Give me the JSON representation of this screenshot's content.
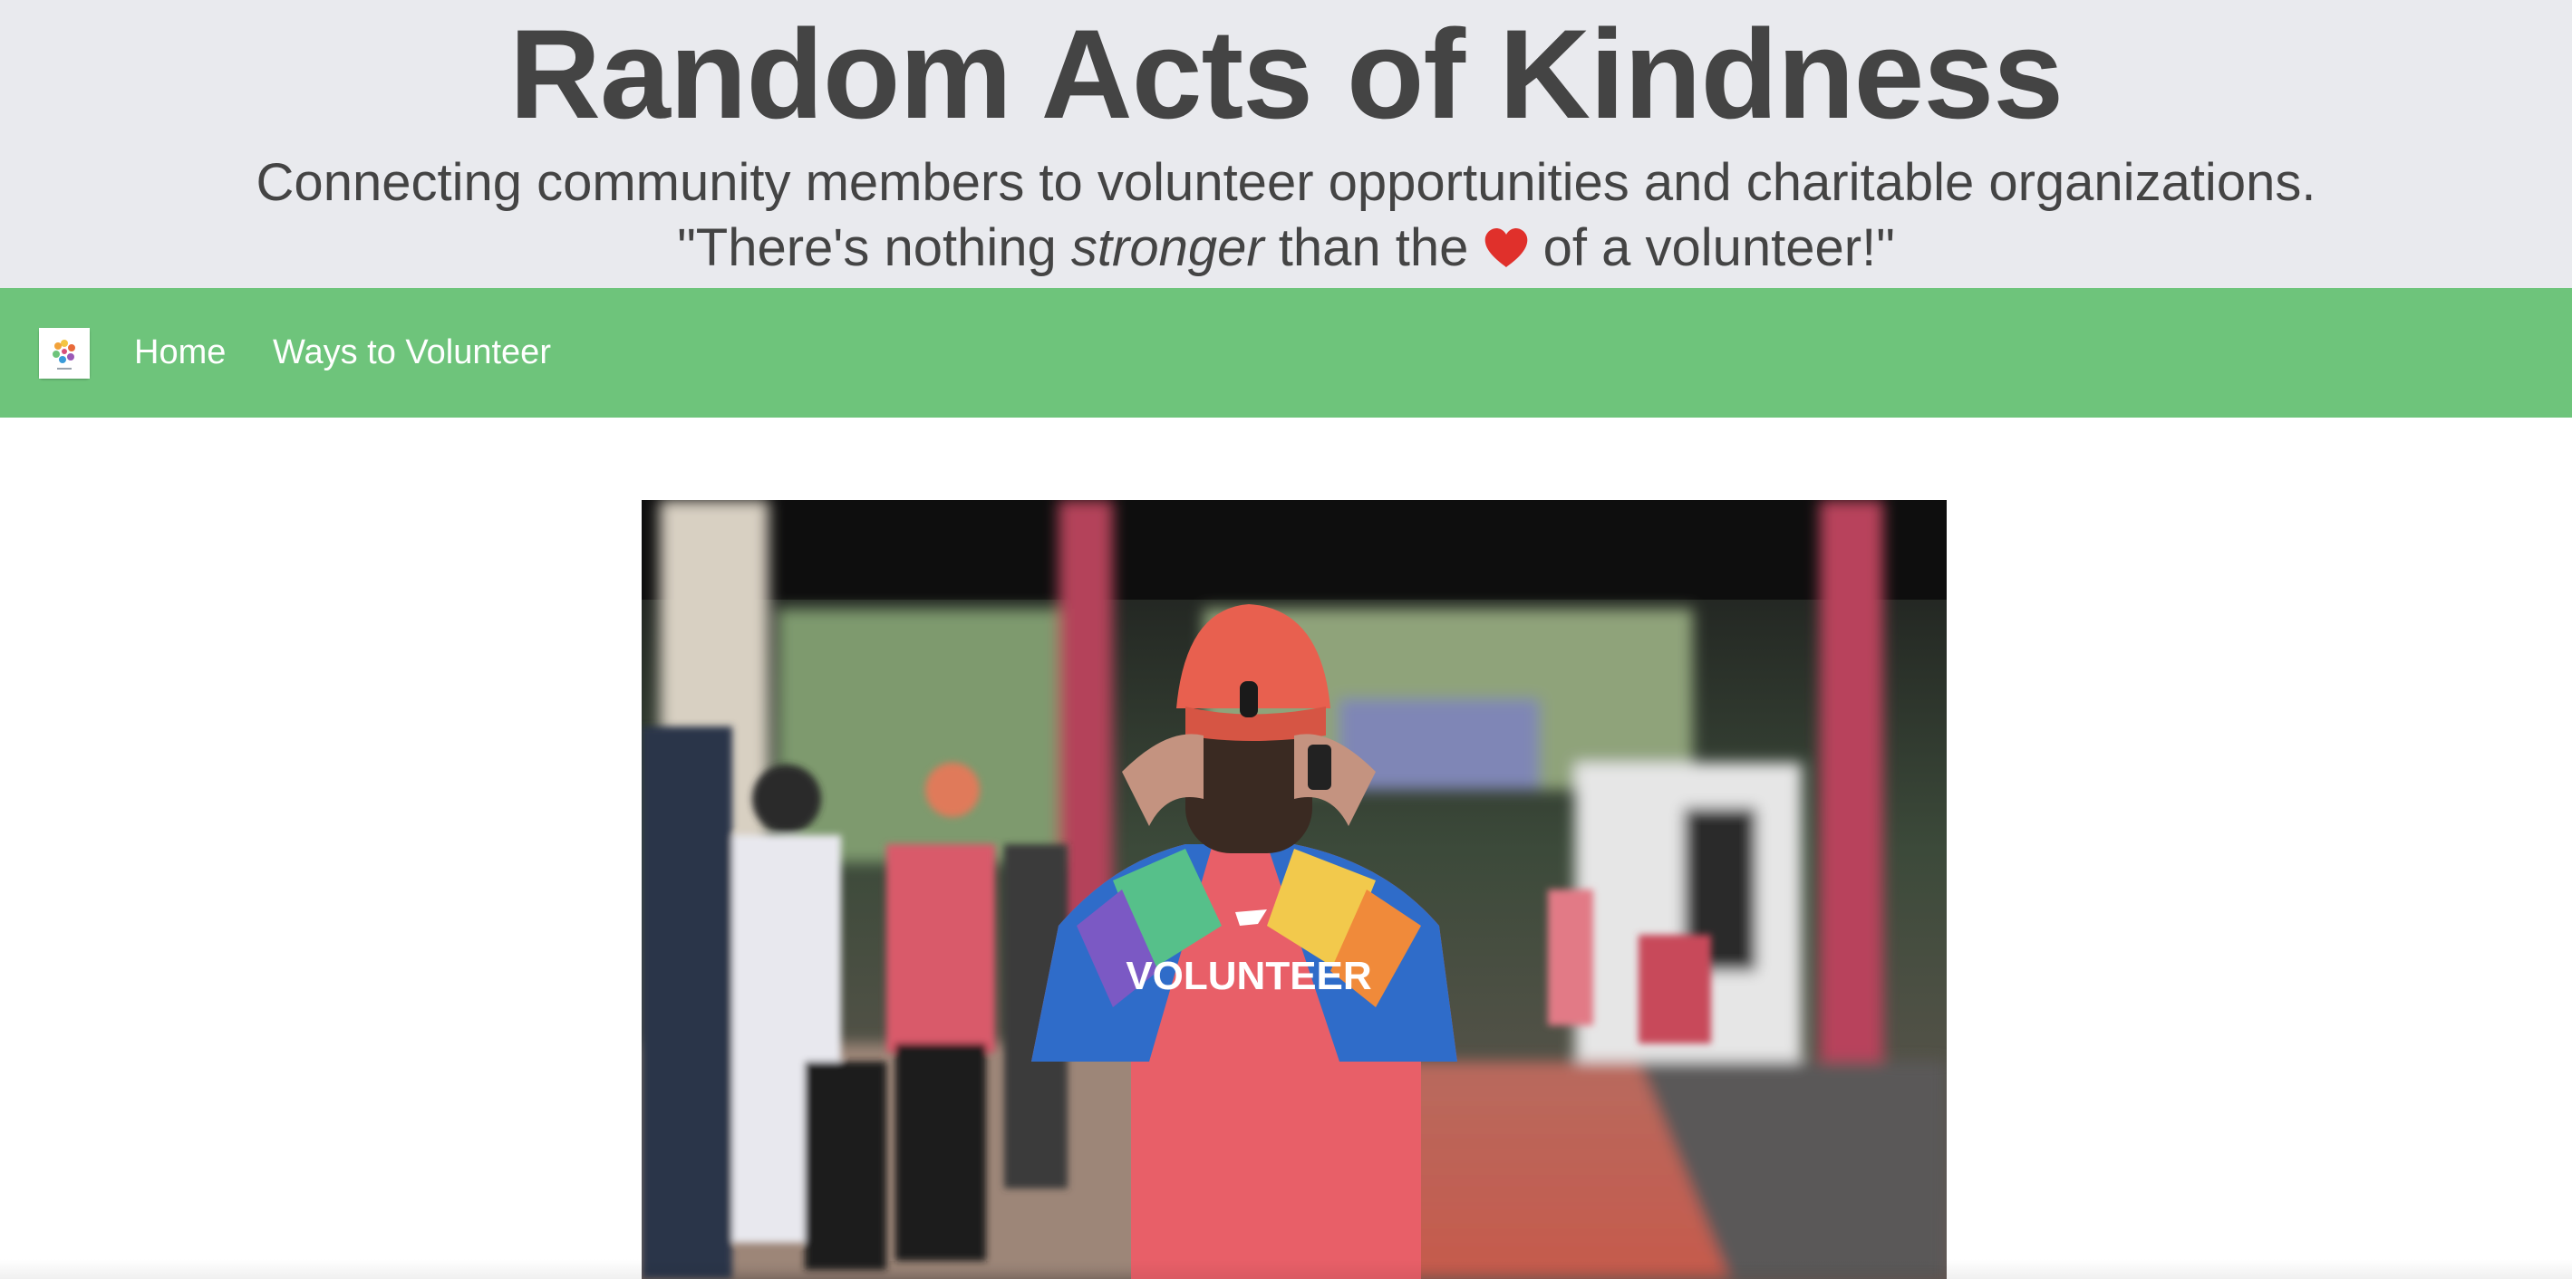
{
  "header": {
    "title": "Random Acts of Kindness",
    "tagline": "Connecting community members to volunteer opportunities and charitable organizations.",
    "quote": {
      "open": "\"There's nothing ",
      "emphasis": "stronger",
      "middle": " than the ",
      "heart_icon": "heart-icon",
      "close": " of a volunteer!\""
    }
  },
  "navbar": {
    "logo_icon": "organization-logo",
    "links": [
      {
        "label": "Home"
      },
      {
        "label": "Ways to Volunteer"
      }
    ]
  },
  "hero": {
    "image_subject": "volunteer-photo",
    "shirt_text": "VOLUNTEER"
  },
  "colors": {
    "header_bg": "#e9eaee",
    "navbar_bg": "#6ec47b",
    "title_text": "#444444",
    "heart": "#e0302b"
  }
}
